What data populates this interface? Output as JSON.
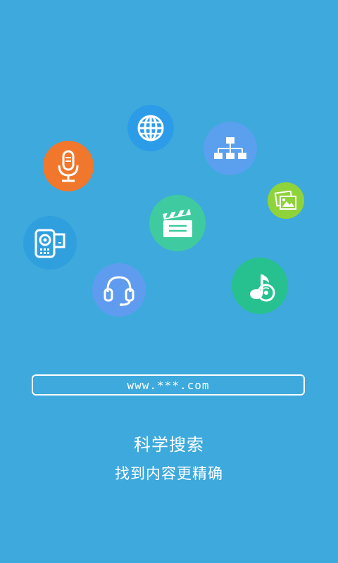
{
  "icons": [
    {
      "name": "globe-icon",
      "color": "#2d9ce8"
    },
    {
      "name": "sitemap-icon",
      "color": "#5aa0ee"
    },
    {
      "name": "microphone-icon",
      "color": "#f0772c"
    },
    {
      "name": "photo-icon",
      "color": "#8fd33a"
    },
    {
      "name": "clapperboard-icon",
      "color": "#3fcb9f"
    },
    {
      "name": "video-camera-icon",
      "color": "#2f9fde"
    },
    {
      "name": "headset-icon",
      "color": "#5f9cef"
    },
    {
      "name": "music-disc-icon",
      "color": "#27c18f"
    }
  ],
  "url_field": {
    "value": "www.***.com"
  },
  "headline": {
    "title": "科学搜索",
    "subtitle": "找到内容更精确"
  },
  "colors": {
    "background": "#3ea9dc"
  }
}
